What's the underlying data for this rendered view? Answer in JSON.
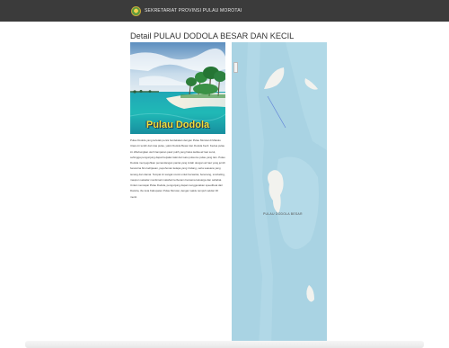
{
  "header": {
    "brand": "SEKRETARIAT PROVINSI PULAU MOROTAI"
  },
  "main": {
    "title": "Detail PULAU DODOLA BESAR DAN KECIL",
    "image_caption": "Pulau Dodola",
    "description": "Pulau Dodola yang terletak persis berdekatan dengan Pulau Morotai di Maluku Utara ini terdiri dari dua pulau, yakni Dodola Besar dan Dodola Kecil. Kedua pulau ini dihubungkan oleh hamparan pasir putih yang halus ketika air laut surut, sehingga pengunjung dapat berjalan kaki dari satu pulau ke pulau yang lain. Pulau Dodola menyuguhkan pemandangan pantai yang indah dengan air laut yang jernih berwarna biru kehijauan, pepohonan kelapa yang rindang, serta suasana yang tenang dan damai. Tempat ini sangat cocok untuk bersantai, berenang, snorkeling, maupun sekadar menikmati matahari terbenam bersama keluarga dan sahabat. Untuk mencapai Pulau Dodola, pengunjung dapat menggunakan speedboat dari Daruba, ibu kota Kabupaten Pulau Morotai, dengan waktu tempuh sekitar 30 menit."
  },
  "map": {
    "label": "PULAU DODOLA BESAR",
    "colors": {
      "water": "#a9d3e3",
      "shallow": "#c3e3ec",
      "land": "#f2f2ee"
    }
  }
}
